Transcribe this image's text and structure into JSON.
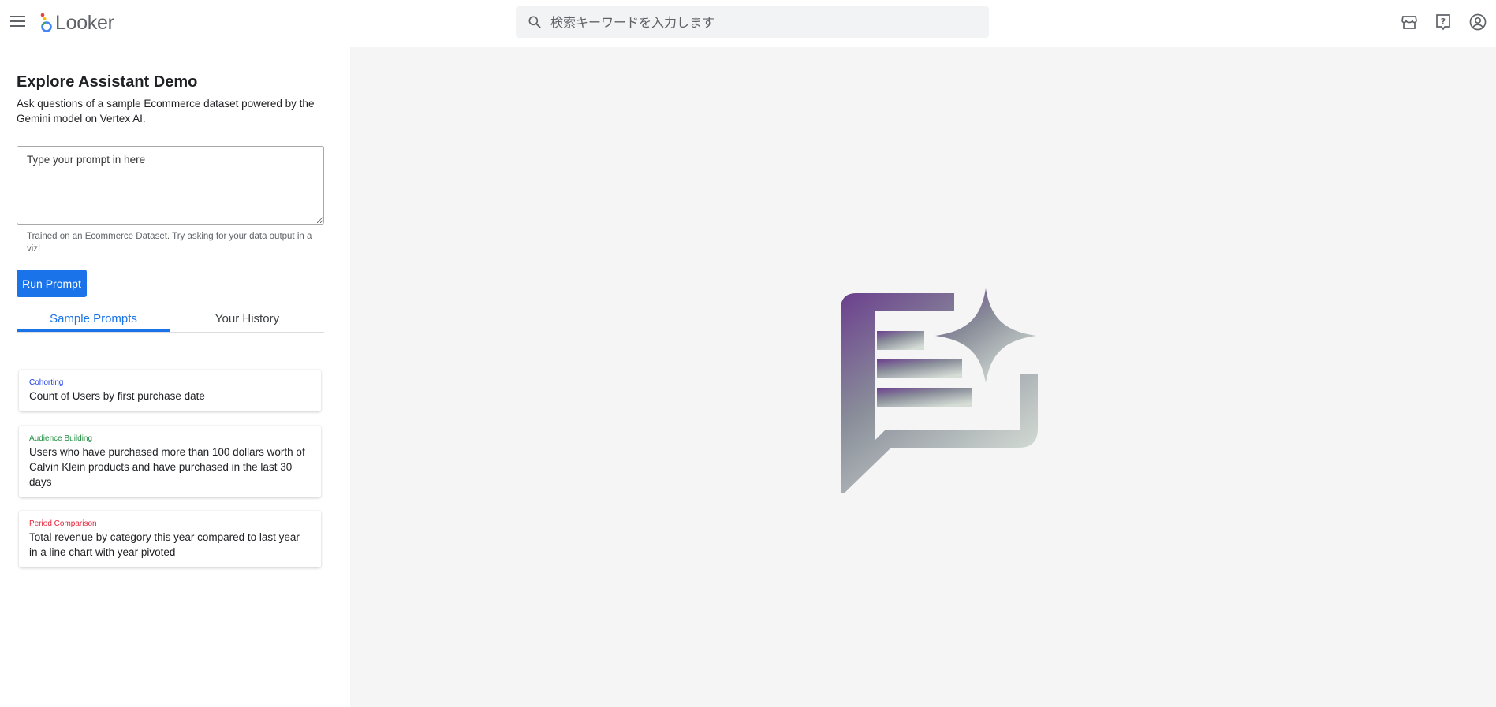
{
  "app": {
    "name": "Looker",
    "search_placeholder": "検索キーワードを入力します"
  },
  "top_icons": [
    "marketplace-icon",
    "help-icon",
    "account-icon"
  ],
  "panel": {
    "title": "Explore Assistant Demo",
    "subtitle": "Ask questions of a sample Ecommerce dataset powered by the Gemini model on Vertex AI.",
    "prompt_placeholder": "Type your prompt in here",
    "hint": "Trained on an Ecommerce Dataset. Try asking for your data output in a viz!",
    "run_label": "Run Prompt"
  },
  "tabs": [
    {
      "label": "Sample Prompts",
      "active": true
    },
    {
      "label": "Your History",
      "active": false
    }
  ],
  "samples": [
    {
      "category": "Cohorting",
      "color": "#1a3fe8",
      "text": "Count of Users by first purchase date"
    },
    {
      "category": "Audience Building",
      "color": "#1e8e3e",
      "text": "Users who have purchased more than 100 dollars worth of Calvin Klein products and have purchased in the last 30 days"
    },
    {
      "category": "Period Comparison",
      "color": "#e8243a",
      "text": "Total revenue by category this year compared to last year in a line chart with year pivoted"
    }
  ],
  "colors": {
    "accent": "#1a73e8",
    "hero_gradient_start": "#6b3f8e",
    "hero_gradient_end": "#d5ddd6"
  }
}
